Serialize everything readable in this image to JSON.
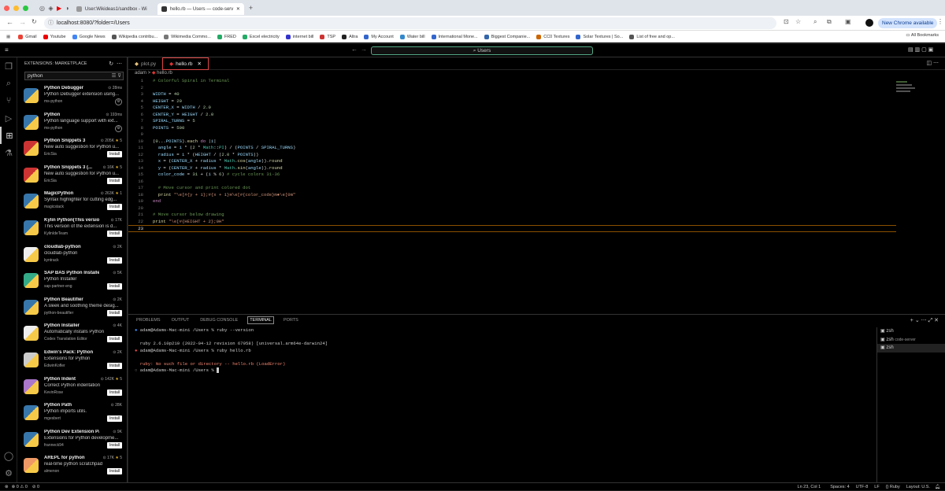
{
  "browser": {
    "tabs": [
      {
        "label": "User:Wikideas1/sandbox - Wi",
        "active": false
      },
      {
        "label": "hello.rb — Users — code-serv",
        "active": true
      }
    ],
    "url": "localhost:8080/?folder=/Users",
    "new_chrome": "New Chrome available",
    "bookmarks": [
      "Gmail",
      "Youtube",
      "Google News",
      "Wikipedia contribu...",
      "Wikimedia Commo...",
      "FRED",
      "Excel electricity",
      "internet bill",
      "TSP",
      "Altra",
      "My Account",
      "Water bill",
      "International Mone...",
      "Biggest Companie...",
      "CC0 Textures",
      "Solar Textures | So...",
      "List of free and op..."
    ],
    "all_bookmarks": "All Bookmarks"
  },
  "vscode": {
    "command_center": "Users",
    "sidebar": {
      "title": "EXTENSIONS: MARKETPLACE",
      "search_value": "python",
      "extensions": [
        {
          "name": "Python Debugger",
          "meta": "28ms",
          "desc": "Python Debugger extension using...",
          "publisher": "ms-python",
          "action": "gear"
        },
        {
          "name": "Python",
          "meta": "193ms",
          "desc": "Python language support with ext...",
          "publisher": "ms-python",
          "action": "gear"
        },
        {
          "name": "Python Snippets 3",
          "meta": "205K",
          "rating": "5",
          "desc": "New auto suggestion for Python u...",
          "publisher": "EricSia",
          "action": "Install"
        },
        {
          "name": "Python Snippets 3 (...",
          "meta": "16K",
          "rating": "5",
          "desc": "New auto suggestion for Python u...",
          "publisher": "EricSia",
          "action": "Install"
        },
        {
          "name": "MagicPython",
          "meta": "263K",
          "rating": "1",
          "desc": "Syntax highlighter for cutting edg...",
          "publisher": "magicstack",
          "action": "Install"
        },
        {
          "name": "Kylin Python(This versio...",
          "meta": "17K",
          "desc": "This version of the extension is d...",
          "publisher": "KylinIdeTeam",
          "action": "Install"
        },
        {
          "name": "cloudlab-python",
          "meta": "2K",
          "desc": "cloudlab-python",
          "publisher": "kyntrack",
          "action": "Install"
        },
        {
          "name": "SAP BAS Python Installer",
          "meta": "5K",
          "desc": "Python Installer",
          "publisher": "sap-partner-eng",
          "action": "Install"
        },
        {
          "name": "Python Beautifier",
          "meta": "2K",
          "desc": "A sleek and soothing theme desig...",
          "publisher": "python-beautifier",
          "action": "Install"
        },
        {
          "name": "Python Installer",
          "meta": "4K",
          "desc": "Automatically installs Python",
          "publisher": "Codex Translation Editor",
          "action": "Install"
        },
        {
          "name": "Edwin's Pack: Python",
          "meta": "2K",
          "desc": "Extensions for Python",
          "publisher": "EdwinKofler",
          "action": "Install"
        },
        {
          "name": "Python Indent",
          "meta": "142K",
          "rating": "5",
          "desc": "Correct Python indentation",
          "publisher": "KevinRose",
          "action": "Install"
        },
        {
          "name": "Python Path",
          "meta": "28K",
          "desc": "Python imports utils.",
          "publisher": "mgesbert",
          "action": "Install"
        },
        {
          "name": "Python Dev Extension Pa...",
          "meta": "9K",
          "desc": "Extensions for Python developme...",
          "publisher": "franneck94",
          "action": "Install"
        },
        {
          "name": "AREPL for python",
          "meta": "17K",
          "rating": "5",
          "desc": "real-time python scratchpad",
          "publisher": "almenon",
          "action": "Install"
        }
      ]
    },
    "editor_tabs": [
      {
        "label": "plot.py",
        "active": false
      },
      {
        "label": "hello.rb",
        "active": true
      }
    ],
    "breadcrumb": [
      "adam",
      "hello.rb"
    ],
    "code_lines": [
      "# Colorful Spiral in Terminal",
      "",
      "WIDTH = 40",
      "HEIGHT = 20",
      "CENTER_X = WIDTH / 2.0",
      "CENTER_Y = HEIGHT / 2.0",
      "SPIRAL_TURNS = 5",
      "POINTS = 500",
      "",
      "(0...POINTS).each do |i|",
      "  angle = i * (2 * Math::PI) / (POINTS / SPIRAL_TURNS)",
      "  radius = i * (HEIGHT / (2.0 * POINTS))",
      "  x = (CENTER_X + radius * Math.cos(angle)).round",
      "  y = (CENTER_Y + radius * Math.sin(angle)).round",
      "  color_code = 31 + (i % 6) # cycle colors 31-36",
      "",
      "  # Move cursor and print colored dot",
      "  print \"\\e[#{y + 1};#{x + 1}H\\e[#{color_code}m●\\e[0m\"",
      "end",
      "",
      "# Move cursor below drawing",
      "print \"\\e[#{HEIGHT + 2};0H\"",
      ""
    ],
    "panel_tabs": [
      "PROBLEMS",
      "OUTPUT",
      "DEBUG CONSOLE",
      "TERMINAL",
      "PORTS"
    ],
    "terminal_lines": [
      "adam@Adams-Mac-mini /Users % ruby --version",
      "ruby 2.6.10p210 (2022-04-12 revision 67958) [universal.arm64e-darwin24]",
      "adam@Adams-Mac-mini /Users % ruby hello.rb",
      "ruby: No such file or directory -- hello.rb (LoadError)",
      "adam@Adams-Mac-mini /Users % "
    ],
    "terminal_list": [
      {
        "name": "zsh",
        "sub": ""
      },
      {
        "name": "zsh",
        "sub": "code-server"
      },
      {
        "name": "zsh",
        "sub": ""
      }
    ],
    "status": {
      "errors": "0",
      "warnings": "0",
      "ports": "0",
      "position": "Ln 23, Col 1",
      "spaces": "Spaces: 4",
      "encoding": "UTF-8",
      "eol": "LF",
      "language": "Ruby",
      "layout": "Layout: U.S."
    }
  }
}
